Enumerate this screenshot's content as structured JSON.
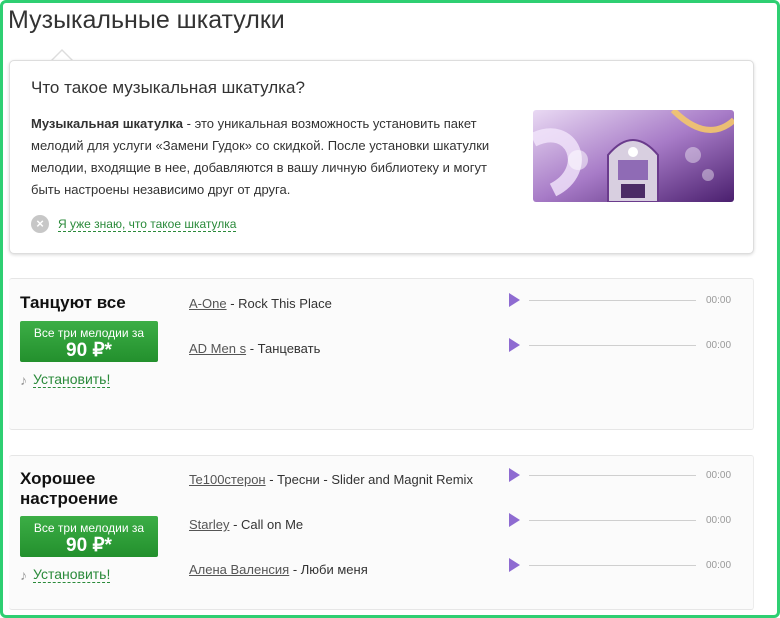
{
  "page": {
    "title": "Музыкальные шкатулки"
  },
  "info": {
    "heading": "Что такое музыкальная шкатулка?",
    "term": "Музыкальная шкатулка",
    "description": " - это уникальная возможность установить пакет мелодий для услуги «Замени Гудок» со скидкой. После установки шкатулки мелодии, входящие в нее, добавляются в вашу личную библиотеку и могут быть настроены независимо друг от друга.",
    "dismiss_label": "Я уже знаю, что такое шкатулка",
    "dismiss_icon": "×",
    "image_icon": "jukebox-illustration"
  },
  "boxes": [
    {
      "title": "Танцуют все",
      "price_caption": "Все три мелодии за",
      "price_value": "90 ₽*",
      "install_label": "Установить!",
      "note_icon": "♪",
      "tracks": [
        {
          "artist": "A-One",
          "song": " - Rock This Place",
          "time": "00:00"
        },
        {
          "artist": "AD Men s",
          "song": " - Танцевать",
          "time": "00:00"
        }
      ]
    },
    {
      "title": "Хорошее настроение",
      "price_caption": "Все три мелодии за",
      "price_value": "90 ₽*",
      "install_label": "Установить!",
      "note_icon": "♪",
      "tracks": [
        {
          "artist": "Te100стерон",
          "song": " - Тресни - Slider and Magnit Remix",
          "time": "00:00"
        },
        {
          "artist": "Starley",
          "song": " - Call on Me",
          "time": "00:00"
        },
        {
          "artist": "Алена Валенсия",
          "song": " - Люби меня",
          "time": "00:00"
        }
      ]
    }
  ],
  "colors": {
    "accent_green": "#2ecf72",
    "button_green": "#23902d",
    "play_purple": "#8e6bd1"
  }
}
